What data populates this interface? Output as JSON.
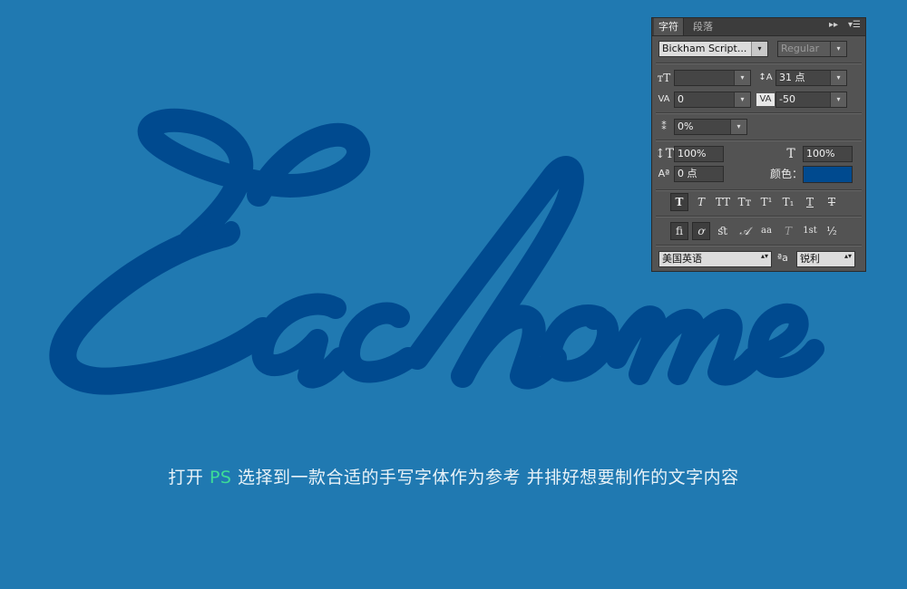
{
  "canvas": {
    "background": "#2079b1",
    "script_text": "Eachome",
    "script_color": "#004a8f",
    "caption": {
      "before": "打开 ",
      "highlight": "PS",
      "after": " 选择到一款合适的手写字体作为参考 并排好想要制作的文字内容",
      "highlight_color": "#3ddc97"
    }
  },
  "panel": {
    "tabs": [
      {
        "label": "字符",
        "active": true
      },
      {
        "label": "段落",
        "active": false
      }
    ],
    "controls": {
      "expand": "▸▸",
      "menu": "▾☰"
    },
    "font_family": "Bickham Script...",
    "font_style": "Regular",
    "font_size": "",
    "leading": "31 点",
    "kerning": "0",
    "tracking": "-50",
    "tsume": "0%",
    "vertical_scale": "100%",
    "horizontal_scale": "100%",
    "baseline_shift": "0 点",
    "color_label": "颜色：",
    "color_value": "#004a8f",
    "language": "美国英语",
    "antialias_icon_text": "ªa",
    "antialias": "锐利",
    "style_buttons": [
      "T",
      "T",
      "TT",
      "Tт",
      "T¹",
      "T₁",
      "T",
      "T"
    ],
    "opentype_buttons": [
      "ﬁ",
      "ơ",
      "ﬆ",
      "𝒜",
      "aa",
      "T",
      "1st",
      "½"
    ],
    "dropdown_arrow": "▾",
    "spin_arrows": "▴▾"
  }
}
